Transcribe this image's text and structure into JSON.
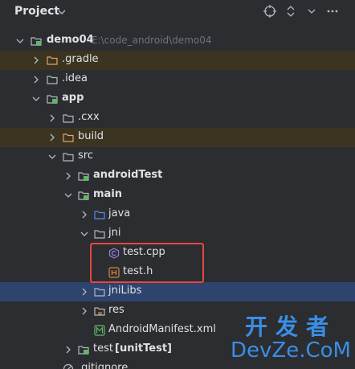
{
  "header": {
    "title": "Project"
  },
  "tree": {
    "project": {
      "name": "demo04",
      "path": "E:\\code_android\\demo04"
    },
    "gradle": ".gradle",
    "idea": ".idea",
    "app": "app",
    "cxx": ".cxx",
    "build": "build",
    "src": "src",
    "androidTest": "androidTest",
    "main": "main",
    "java": "java",
    "jni": "jni",
    "test_cpp": "test.cpp",
    "test_h": "test.h",
    "jniLibs": "jniLibs",
    "res": "res",
    "manifest": "AndroidManifest.xml",
    "test_name": "test",
    "test_suffix": "[unitTest]",
    "gitignore": ".gitignore"
  },
  "watermark": {
    "line1": "开发者",
    "line2": "DevZe.CoM"
  },
  "colors": {
    "panel_bg": "#2b2d30",
    "highlight_row": "#3b3421",
    "selected_row": "#2e436e",
    "folder_blue": "#548af7",
    "folder_orange": "#e4a06a",
    "module_green": "#5fb865",
    "cpp_purple": "#9b7ee6",
    "header_orange": "#d9853b",
    "annotation_red": "#e8463e"
  },
  "icons": {
    "header": [
      "crosshair-icon",
      "expand-collapse-icon",
      "close-icon",
      "more-icon"
    ]
  }
}
